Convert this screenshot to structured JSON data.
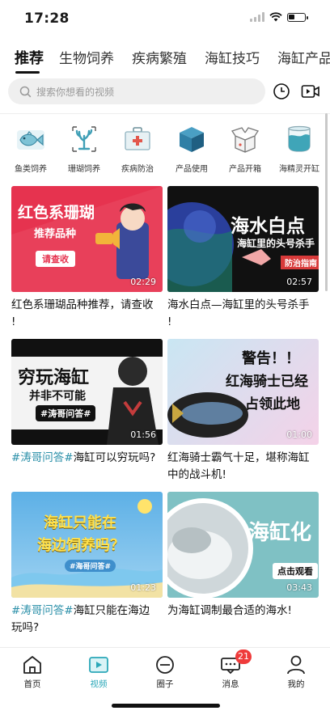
{
  "status": {
    "time": "17:28"
  },
  "tabs": [
    {
      "label": "推荐",
      "active": true
    },
    {
      "label": "生物饲养"
    },
    {
      "label": "疾病繁殖"
    },
    {
      "label": "海缸技巧"
    },
    {
      "label": "海缸产品"
    }
  ],
  "search": {
    "placeholder": "搜索你想看的视频"
  },
  "categories": [
    {
      "label": "鱼类饲养",
      "icon": "fish-icon"
    },
    {
      "label": "珊瑚饲养",
      "icon": "coral-icon"
    },
    {
      "label": "疾病防治",
      "icon": "medkit-icon"
    },
    {
      "label": "产品使用",
      "icon": "box-icon"
    },
    {
      "label": "产品开箱",
      "icon": "open-box-icon"
    },
    {
      "label": "海精灵开缸",
      "icon": "tank-icon"
    }
  ],
  "videos": [
    {
      "title_lines": [
        "红色系珊瑚品种推荐，请查收",
        "!"
      ],
      "duration": "02:29",
      "thumb": {
        "line1": "红色系珊瑚",
        "line2": "推荐品种",
        "button": "请查收"
      }
    },
    {
      "title_lines": [
        "海水白点—海缸里的头号杀手",
        "!"
      ],
      "duration": "02:57",
      "thumb": {
        "line1": "海水白点",
        "line2": "海缸里的头号杀手",
        "tag": "防治指南"
      }
    },
    {
      "tag": "#涛哥问答#",
      "title_lines": [
        "海缸可以穷玩吗?"
      ],
      "duration": "01:56",
      "thumb": {
        "line1": "穷玩海缸",
        "line2": "并非不可能",
        "tag": "#涛哥问答#"
      }
    },
    {
      "title_lines": [
        "红海骑士霸气十足，堪称海缸",
        "中的战斗机!"
      ],
      "duration": "01:00",
      "thumb": {
        "line1": "警告！！",
        "line2": "红海骑士已经",
        "line3": "占领此地"
      }
    },
    {
      "tag": "#涛哥问答#",
      "title_lines": [
        "海缸只能在海边",
        "玩吗?"
      ],
      "duration": "01:23",
      "thumb": {
        "line1": "海缸只能在",
        "line2": "海边饲养吗？",
        "tag": "#海哥问答#"
      }
    },
    {
      "title_lines": [
        "为海缸调制最合适的海水!"
      ],
      "duration": "03:43",
      "thumb": {
        "line1": "海缸化",
        "button": "点击观看"
      }
    }
  ],
  "bottom_nav": [
    {
      "label": "首页",
      "icon": "home-icon"
    },
    {
      "label": "视频",
      "icon": "video-play-icon",
      "active": true
    },
    {
      "label": "圈子",
      "icon": "circle-icon"
    },
    {
      "label": "消息",
      "icon": "message-icon",
      "badge": "21"
    },
    {
      "label": "我的",
      "icon": "profile-icon"
    }
  ]
}
